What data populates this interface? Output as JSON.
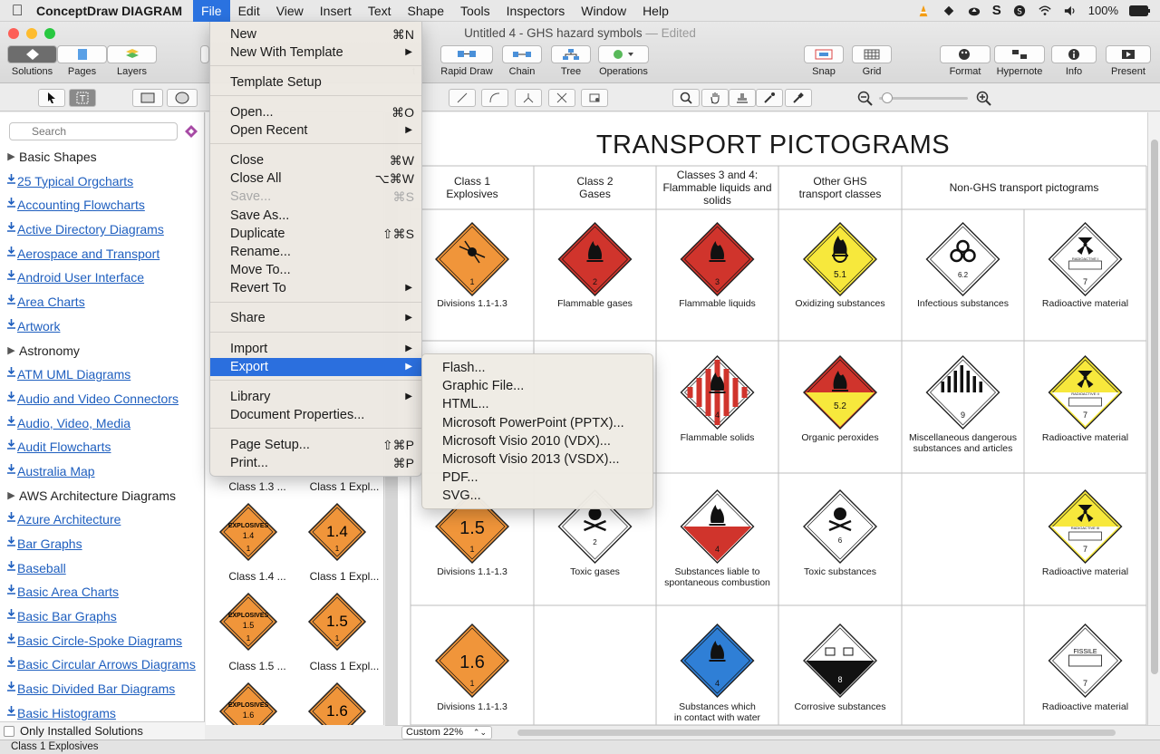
{
  "menubar": {
    "app_name": "ConceptDraw DIAGRAM",
    "items": [
      "File",
      "Edit",
      "View",
      "Insert",
      "Text",
      "Shape",
      "Tools",
      "Inspectors",
      "Window",
      "Help"
    ],
    "battery": "100%"
  },
  "window": {
    "title": "Untitled 4 - GHS hazard symbols",
    "edited": " — Edited"
  },
  "toolbar": {
    "solutions": "Solutions",
    "pages": "Pages",
    "layers": "Layers",
    "smart": "t",
    "rapid_draw": "Rapid Draw",
    "chain": "Chain",
    "tree": "Tree",
    "operations": "Operations",
    "snap": "Snap",
    "grid": "Grid",
    "format": "Format",
    "hypernote": "Hypernote",
    "info": "Info",
    "present": "Present"
  },
  "sidebar": {
    "search_placeholder": "Search",
    "items": [
      {
        "label": "Basic Shapes",
        "kind": "folder"
      },
      {
        "label": "25 Typical Orgcharts",
        "kind": "download"
      },
      {
        "label": "Accounting Flowcharts",
        "kind": "download"
      },
      {
        "label": "Active Directory Diagrams",
        "kind": "download"
      },
      {
        "label": "Aerospace and Transport",
        "kind": "download"
      },
      {
        "label": "Android User Interface",
        "kind": "download"
      },
      {
        "label": "Area Charts",
        "kind": "download"
      },
      {
        "label": "Artwork",
        "kind": "download"
      },
      {
        "label": "Astronomy",
        "kind": "folder"
      },
      {
        "label": "ATM UML Diagrams",
        "kind": "download"
      },
      {
        "label": "Audio and Video Connectors",
        "kind": "download"
      },
      {
        "label": "Audio, Video, Media",
        "kind": "download"
      },
      {
        "label": "Audit Flowcharts",
        "kind": "download"
      },
      {
        "label": "Australia Map",
        "kind": "download"
      },
      {
        "label": "AWS Architecture Diagrams",
        "kind": "folder"
      },
      {
        "label": "Azure Architecture",
        "kind": "download"
      },
      {
        "label": "Bar Graphs",
        "kind": "download"
      },
      {
        "label": "Baseball",
        "kind": "download"
      },
      {
        "label": "Basic Area Charts",
        "kind": "download"
      },
      {
        "label": "Basic Bar Graphs",
        "kind": "download"
      },
      {
        "label": "Basic Circle-Spoke Diagrams",
        "kind": "download"
      },
      {
        "label": "Basic Circular Arrows Diagrams",
        "kind": "download"
      },
      {
        "label": "Basic Divided Bar Diagrams",
        "kind": "download"
      },
      {
        "label": "Basic Histograms",
        "kind": "download"
      }
    ],
    "only_installed": "Only Installed Solutions"
  },
  "statusbar": {
    "text": "Class 1 Explosives"
  },
  "library_panel": {
    "labels": [
      "Class 1.3 ...",
      "Class 1 Expl...",
      "Class 1.4 ...",
      "Class 1 Expl...",
      "Class 1.5 ...",
      "Class 1 Expl..."
    ],
    "pictos": [
      {
        "top": "EXPLOSIVES",
        "num": "1.4",
        "div": "1"
      },
      {
        "top": "",
        "num": "1.4",
        "div": "1"
      },
      {
        "top": "EXPLOSIVES",
        "num": "1.5",
        "div": "1"
      },
      {
        "top": "",
        "num": "1.5",
        "div": "1"
      },
      {
        "top": "EXPLOSIVES",
        "num": "1.6",
        "div": "1"
      },
      {
        "top": "",
        "num": "1.6",
        "div": "1"
      }
    ]
  },
  "canvas": {
    "title": "TRANSPORT PICTOGRAMS",
    "zoom": "Custom 22%",
    "headers": [
      "Class 1\nExplosives",
      "Class 2\nGases",
      "Classes 3 and 4:\nFlammable liquids and\nsolids",
      "Other GHS\ntransport classes",
      "Non-GHS transport pictograms"
    ],
    "labels": {
      "r1": [
        "Divisions 1.1-1.3",
        "Flammable gases",
        "Flammable liquids",
        "Oxidizing substances",
        "Infectious substances",
        "Radioactive material"
      ],
      "r2": [
        "",
        "",
        "Flammable solids",
        "Organic peroxides",
        "Miscellaneous dangerous\nsubstances and articles",
        "Radioactive material"
      ],
      "r3": [
        "Divisions 1.1-1.3",
        "Toxic gases",
        "Substances liable to\nspontaneous combustion",
        "Toxic substances",
        "",
        "Radioactive material"
      ],
      "r4": [
        "Divisions 1.1-1.3",
        "",
        "Substances which\nin contact  with water",
        "Corrosive substances",
        "",
        "Radioactive material"
      ]
    },
    "sign_text": {
      "oxidizer": "5.1",
      "peroxide": "5.2",
      "infect": "6.2",
      "misc": "9",
      "toxic": "6",
      "corrosive": "8",
      "explosive_div": "1.5",
      "explosive_div2": "1.6",
      "radioactive_1": "RADIOACTIVE I",
      "radioactive_2": "RADIOACTIVE II",
      "radioactive_3": "RADIOACTIVE III",
      "fissile": "FISSILE"
    }
  },
  "file_menu": {
    "items": [
      {
        "label": "New",
        "sc": "⌘N"
      },
      {
        "label": "New With Template",
        "arrow": true
      },
      {
        "label": "Template Setup"
      },
      {
        "label": "Open...",
        "sc": "⌘O"
      },
      {
        "label": "Open Recent",
        "arrow": true
      },
      {
        "label": "Close",
        "sc": "⌘W"
      },
      {
        "label": "Close All",
        "sc": "⌥⌘W"
      },
      {
        "label": "Save...",
        "sc": "⌘S",
        "disabled": true
      },
      {
        "label": "Save As..."
      },
      {
        "label": "Duplicate",
        "sc": "⇧⌘S"
      },
      {
        "label": "Rename..."
      },
      {
        "label": "Move To..."
      },
      {
        "label": "Revert To",
        "arrow": true
      },
      {
        "label": "Share",
        "arrow": true
      },
      {
        "label": "Import",
        "arrow": true
      },
      {
        "label": "Export",
        "arrow": true,
        "highlight": true
      },
      {
        "label": "Library",
        "arrow": true
      },
      {
        "label": "Document Properties..."
      },
      {
        "label": "Page Setup...",
        "sc": "⇧⌘P"
      },
      {
        "label": "Print...",
        "sc": "⌘P"
      }
    ]
  },
  "export_menu": {
    "items": [
      "Flash...",
      "Graphic File...",
      "HTML...",
      "Microsoft PowerPoint (PPTX)...",
      "Microsoft Visio 2010 (VDX)...",
      "Microsoft Visio 2013 (VSDX)...",
      "PDF...",
      "SVG..."
    ]
  },
  "colors": {
    "menu_highlight": "#2b6fde",
    "link_blue": "#1f5fbf",
    "explosive_orange": "#f0953a",
    "flammable_red": "#d0342c",
    "oxidizer_yellow": "#f7e83c",
    "water_blue": "#2f7fd6"
  }
}
